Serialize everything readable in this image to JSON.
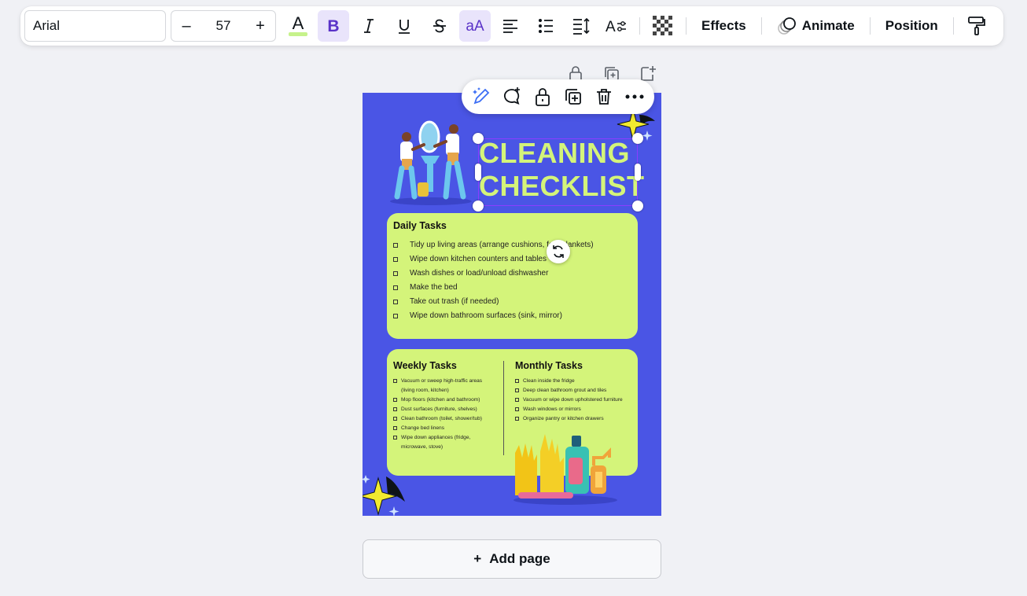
{
  "toolbar": {
    "font_name": "Arial",
    "size_minus": "–",
    "font_size": "57",
    "size_plus": "+",
    "effects_label": "Effects",
    "animate_label": "Animate",
    "position_label": "Position"
  },
  "design": {
    "title_line1": "CLEANING",
    "title_line2": "CHECKLIST",
    "daily": {
      "heading": "Daily Tasks",
      "items": [
        "Tidy up living areas (arrange cushions, fold blankets)",
        "Wipe down kitchen counters and tables",
        "Wash dishes or load/unload dishwasher",
        "Make the bed",
        "Take out trash (if needed)",
        "Wipe down bathroom surfaces (sink, mirror)"
      ]
    },
    "weekly": {
      "heading": "Weekly Tasks",
      "items": [
        "Vacuum or sweep high-traffic areas (living room, kitchen)",
        "Mop floors (kitchen and bathroom)",
        "Dust surfaces (furniture, shelves)",
        "Clean bathroom (toilet, shower/tub)",
        "Change bed linens",
        "Wipe down appliances (fridge, microwave, stove)"
      ]
    },
    "monthly": {
      "heading": "Monthly Tasks",
      "items": [
        "Clean inside the fridge",
        "Deep clean bathroom grout and tiles",
        "Vacuum or wipe down upholstered furniture",
        "Wash windows or mirrors",
        "Organize pantry or kitchen drawers"
      ]
    },
    "colors": {
      "background": "#4a55e5",
      "accent": "#d4f47a"
    }
  },
  "add_page": {
    "icon": "+",
    "label": "Add page"
  }
}
